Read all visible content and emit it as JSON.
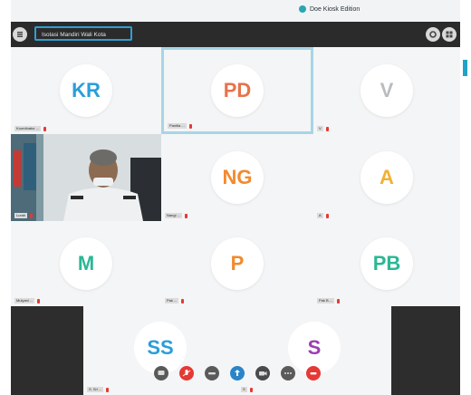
{
  "window": {
    "title": "Doe Kiosk Edition",
    "title_icon": "camera-icon"
  },
  "toolbar": {
    "meeting_name": "Isolasi Mandiri Wali Kota",
    "left_icon": "menu-icon",
    "right_icons": [
      "settings-icon",
      "tile-view-icon"
    ]
  },
  "participants": [
    {
      "initials": "KR",
      "color": "#2a9ed9",
      "name": "Koordinator ...",
      "muted": true,
      "active": false,
      "video": false
    },
    {
      "initials": "PD",
      "color": "#e8734a",
      "name": "Panitia ...",
      "muted": true,
      "active": true,
      "video": false
    },
    {
      "initials": "V",
      "color": "#b9bcbf",
      "name": "V",
      "muted": true,
      "active": false,
      "video": false
    },
    {
      "initials": "",
      "color": "",
      "name": "Lurah",
      "muted": true,
      "active": false,
      "video": true
    },
    {
      "initials": "NG",
      "color": "#f28a2e",
      "name": "Nangi ...",
      "muted": true,
      "active": false,
      "video": false
    },
    {
      "initials": "A",
      "color": "#f2b134",
      "name": "A",
      "muted": true,
      "active": false,
      "video": false
    },
    {
      "initials": "M",
      "color": "#2bb796",
      "name": "Mulyani ...",
      "muted": true,
      "active": false,
      "video": false
    },
    {
      "initials": "P",
      "color": "#f28a2e",
      "name": "Pak ...",
      "muted": true,
      "active": false,
      "video": false
    },
    {
      "initials": "PB",
      "color": "#2bb796",
      "name": "Pak B ...",
      "muted": true,
      "active": false,
      "video": false
    }
  ],
  "bottom_participants": [
    {
      "initials": "SS",
      "color": "#2a9ed9",
      "name": "S. Sri ...",
      "muted": true
    },
    {
      "initials": "S",
      "color": "#9b3fb0",
      "name": "S",
      "muted": true
    }
  ],
  "controls": [
    {
      "name": "chat-control",
      "icon": "chat-icon",
      "color": "#5a5a5a"
    },
    {
      "name": "mic-control",
      "icon": "mic-off-icon",
      "color": "#e53935"
    },
    {
      "name": "hangup-control",
      "icon": "phone-icon",
      "color": "#5a5a5a"
    },
    {
      "name": "share-control",
      "icon": "share-icon",
      "color": "#2a84c9"
    },
    {
      "name": "camera-control",
      "icon": "camera-icon",
      "color": "#4a4a4a"
    },
    {
      "name": "more-control",
      "icon": "more-icon",
      "color": "#5a5a5a"
    },
    {
      "name": "leave-control",
      "icon": "leave-icon",
      "color": "#e53935"
    }
  ],
  "colors": {
    "toolbar": "#2b2b2b",
    "accent": "#2e9fd1",
    "active_border": "#a7d5e6"
  }
}
